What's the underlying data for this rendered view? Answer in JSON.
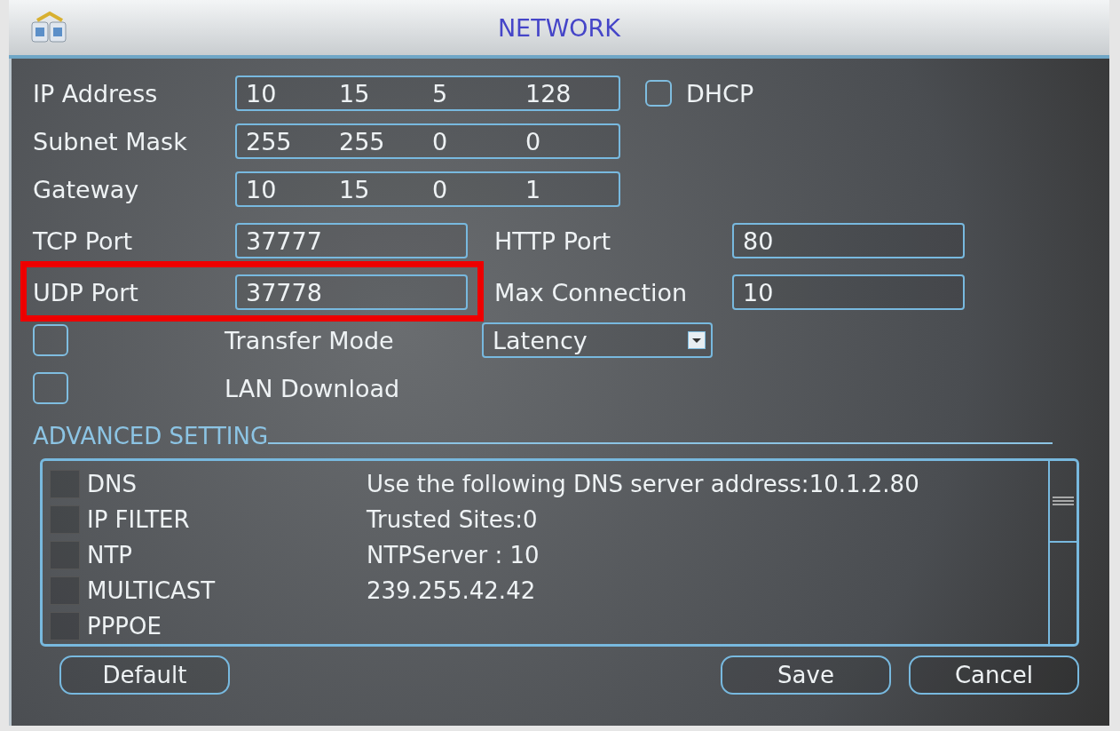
{
  "window": {
    "title": "NETWORK"
  },
  "ip_rows": [
    {
      "label": "IP Address",
      "octets": [
        "10",
        "15",
        "5",
        "128"
      ]
    },
    {
      "label": "Subnet Mask",
      "octets": [
        "255",
        "255",
        "0",
        "0"
      ]
    },
    {
      "label": "Gateway",
      "octets": [
        "10",
        "15",
        "0",
        "1"
      ]
    }
  ],
  "dhcp": {
    "label": "DHCP",
    "checked": false
  },
  "port_rows": [
    {
      "label": "TCP Port",
      "value": "37777",
      "highlighted": false,
      "right_label": "HTTP Port",
      "right_value": "80"
    },
    {
      "label": "UDP Port",
      "value": "37778",
      "highlighted": true,
      "right_label": "Max Connection",
      "right_value": "10"
    }
  ],
  "transfer_mode": {
    "label": "Transfer Mode",
    "checked": false,
    "value": "Latency"
  },
  "lan_download": {
    "label": "LAN Download",
    "checked": false
  },
  "advanced": {
    "title": "ADVANCED SETTING",
    "items": [
      {
        "name": "DNS",
        "checked": false,
        "detail": "Use the following DNS server address:10.1.2.80"
      },
      {
        "name": "IP FILTER",
        "checked": false,
        "detail": "Trusted Sites:0"
      },
      {
        "name": "NTP",
        "checked": false,
        "detail": "NTPServer : 10"
      },
      {
        "name": "MULTICAST",
        "checked": false,
        "detail": "239.255.42.42"
      },
      {
        "name": "PPPOE",
        "checked": false
      }
    ]
  },
  "buttons": [
    {
      "label": "Default"
    },
    {
      "label": "Save"
    },
    {
      "label": "Cancel"
    }
  ]
}
